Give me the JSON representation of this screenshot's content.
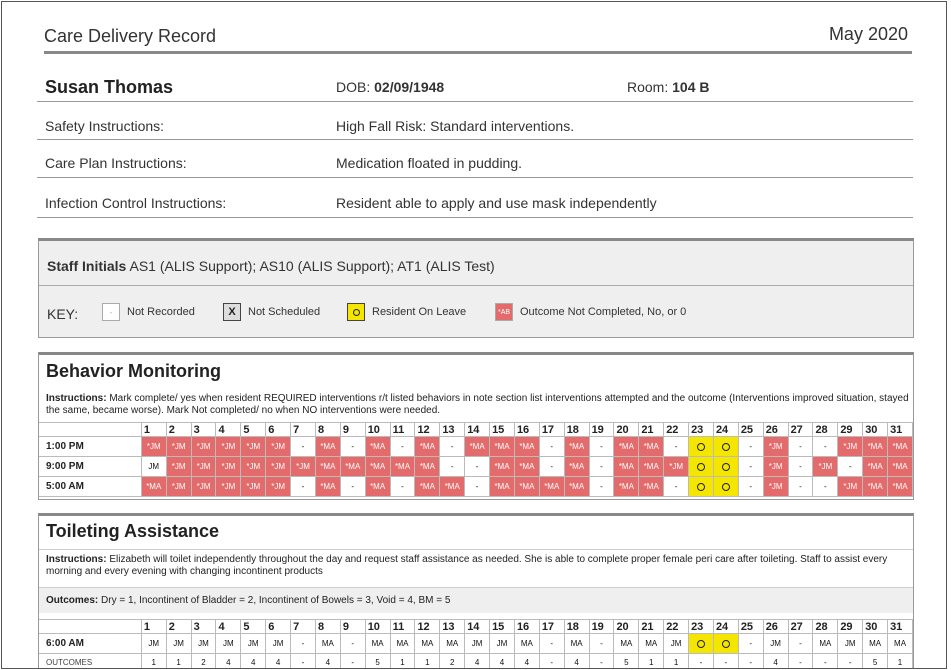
{
  "header": {
    "title": "Care Delivery Record",
    "month": "May 2020"
  },
  "resident": {
    "name": "Susan Thomas",
    "dob_label": "DOB:",
    "dob": "02/09/1948",
    "room_label": "Room:",
    "room": "104 B"
  },
  "instructions": [
    {
      "label": "Safety Instructions:",
      "value": "High Fall Risk: Standard interventions."
    },
    {
      "label": "Care Plan Instructions:",
      "value": "Medication floated in pudding."
    },
    {
      "label": "Infection Control Instructions:",
      "value": "Resident able to apply and use mask independently"
    }
  ],
  "staff": {
    "label": "Staff Initials",
    "value": "AS1 (ALIS Support); AS10 (ALIS Support); AT1 (ALIS Test)"
  },
  "key": {
    "label": "KEY:",
    "items": [
      {
        "symbol": "-",
        "label": "Not Recorded"
      },
      {
        "symbol": "X",
        "label": "Not Scheduled"
      },
      {
        "symbol": "",
        "label": "Resident On Leave"
      },
      {
        "symbol": "*AB",
        "label": "Outcome Not Completed, No, or 0"
      }
    ]
  },
  "behavior": {
    "title": "Behavior Monitoring",
    "instructions_label": "Instructions:",
    "instructions": "Mark complete/ yes when resident REQUIRED interventions r/t listed behaviors in note section list interventions attempted and the outcome (Interventions improved situation, stayed the same, became worse). Mark Not completed/ no when NO interventions were needed.",
    "days": [
      "1",
      "2",
      "3",
      "4",
      "5",
      "6",
      "7",
      "8",
      "9",
      "10",
      "11",
      "12",
      "13",
      "14",
      "15",
      "16",
      "17",
      "18",
      "19",
      "20",
      "21",
      "22",
      "23",
      "24",
      "25",
      "26",
      "27",
      "28",
      "29",
      "30",
      "31"
    ],
    "rows": [
      {
        "label": "1:00 PM",
        "cells": [
          "*JM",
          "*JM",
          "*JM",
          "*JM",
          "*JM",
          "*JM",
          "-",
          "*MA",
          "-",
          "*MA",
          "-",
          "*MA",
          "-",
          "*MA",
          "*MA",
          "*MA",
          "-",
          "*MA",
          "-",
          "*MA",
          "*MA",
          "-",
          "O",
          "O",
          "-",
          "*JM",
          "-",
          "-",
          "*JM",
          "*MA",
          "*MA"
        ]
      },
      {
        "label": "9:00 PM",
        "cells": [
          "JM",
          "*JM",
          "*JM",
          "*JM",
          "*JM",
          "*JM",
          "*JM",
          "*MA",
          "*MA",
          "*MA",
          "*MA",
          "*MA",
          "-",
          "-",
          "*MA",
          "*MA",
          "-",
          "*MA",
          "-",
          "*MA",
          "*MA",
          "*JM",
          "O",
          "O",
          "-",
          "*JM",
          "-",
          "*JM",
          "-",
          "*MA",
          "*MA"
        ]
      },
      {
        "label": "5:00 AM",
        "cells": [
          "*MA",
          "*JM",
          "*JM",
          "*JM",
          "*JM",
          "*JM",
          "-",
          "*MA",
          "-",
          "*MA",
          "-",
          "*MA",
          "*MA",
          "-",
          "*MA",
          "*MA",
          "*MA",
          "*MA",
          "-",
          "*MA",
          "*MA",
          "-",
          "O",
          "O",
          "-",
          "*JM",
          "-",
          "-",
          "*JM",
          "*MA",
          "*MA"
        ]
      }
    ]
  },
  "toileting": {
    "title": "Toileting Assistance",
    "instructions_label": "Instructions:",
    "instructions": "Elizabeth will toilet independently throughout the day and request staff assistance as needed. She is able to complete proper female peri care after toileting. Staff to assist every morning and every evening with changing incontinent products",
    "outcomes_label": "Outcomes:",
    "outcomes": "Dry = 1, Incontinent of Bladder = 2, Incontinent of Bowels = 3, Void = 4, BM = 5",
    "days": [
      "1",
      "2",
      "3",
      "4",
      "5",
      "6",
      "7",
      "8",
      "9",
      "10",
      "11",
      "12",
      "13",
      "14",
      "15",
      "16",
      "17",
      "18",
      "19",
      "20",
      "21",
      "22",
      "23",
      "24",
      "25",
      "26",
      "27",
      "28",
      "29",
      "30",
      "31"
    ],
    "rows": [
      {
        "label": "6:00 AM",
        "cells": [
          "JM",
          "JM",
          "JM",
          "JM",
          "JM",
          "JM",
          "-",
          "MA",
          "-",
          "MA",
          "MA",
          "MA",
          "MA",
          "JM",
          "JM",
          "MA",
          "-",
          "MA",
          "-",
          "MA",
          "MA",
          "JM",
          "O",
          "O",
          "-",
          "JM",
          "-",
          "MA",
          "JM",
          "MA",
          "MA"
        ]
      }
    ],
    "outcome_row": {
      "label": "OUTCOMES",
      "cells": [
        "1",
        "1",
        "2",
        "4",
        "4",
        "4",
        "-",
        "4",
        "-",
        "5",
        "1",
        "1",
        "2",
        "4",
        "4",
        "4",
        "-",
        "4",
        "-",
        "5",
        "1",
        "1",
        "-",
        "-",
        "-",
        "4",
        "-",
        "-",
        "-",
        "5",
        "1"
      ]
    }
  },
  "colors": {
    "not_completed": "#e46b6b",
    "on_leave": "#f5e600",
    "rule": "#888888"
  }
}
